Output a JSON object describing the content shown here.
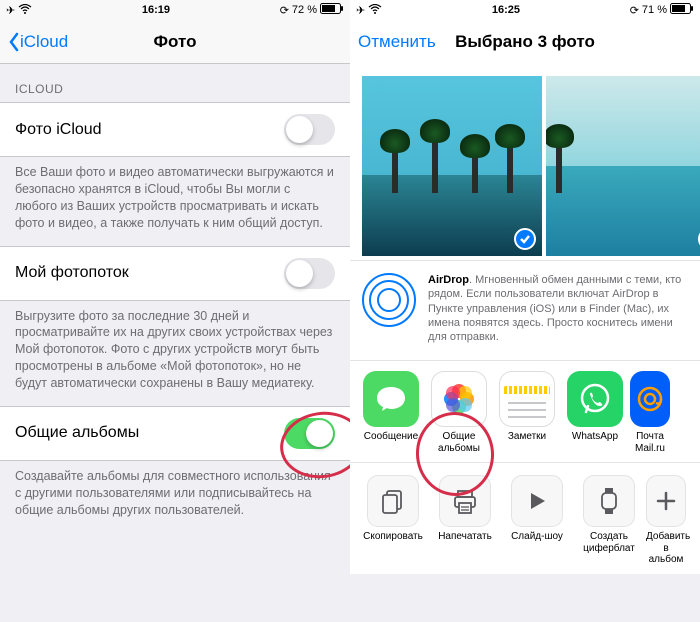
{
  "left": {
    "status": {
      "time": "16:19",
      "battery": "72 %"
    },
    "nav": {
      "back": "iCloud",
      "title": "Фото"
    },
    "section_header": "ICLOUD",
    "rows": [
      {
        "label": "Фото iCloud",
        "on": false,
        "desc": "Все Ваши фото и видео автоматически выгружаются и безопасно хранятся в iCloud, чтобы Вы могли с любого из Ваших устройств просматривать и искать фото и видео, а также получать к ним общий доступ."
      },
      {
        "label": "Мой фотопоток",
        "on": false,
        "desc": "Выгрузите фото за последние 30 дней и просматривайте их на других своих устройствах через Мой фотопоток. Фото с других устройств могут быть просмотрены в альбоме «Мой фотопоток», но не будут автоматически сохранены в Вашу медиатеку."
      },
      {
        "label": "Общие альбомы",
        "on": true,
        "desc": "Создавайте альбомы для совместного использования с другими пользователями или подписывайтесь на общие альбомы других пользователей."
      }
    ]
  },
  "right": {
    "status": {
      "time": "16:25",
      "battery": "71 %"
    },
    "nav": {
      "cancel": "Отменить",
      "title": "Выбрано 3 фото"
    },
    "airdrop": {
      "name": "AirDrop",
      "text": ". Мгновенный обмен данными с теми, кто рядом. Если пользователи включат AirDrop в Пункте управления (iOS) или в Finder (Mac), их имена появятся здесь. Просто коснитесь имени для отправки."
    },
    "share_apps": [
      {
        "label": "Сообщение",
        "color": "#4cd964",
        "icon": "message"
      },
      {
        "label": "Общие альбомы",
        "color": "#ffffff",
        "icon": "photos"
      },
      {
        "label": "Заметки",
        "color": "#fff9c4",
        "icon": "notes"
      },
      {
        "label": "WhatsApp",
        "color": "#25d366",
        "icon": "whatsapp"
      },
      {
        "label": "Почта Mail.ru",
        "color": "#005ff9",
        "icon": "mailru"
      }
    ],
    "actions": [
      {
        "label": "Скопировать",
        "icon": "copy"
      },
      {
        "label": "Напечатать",
        "icon": "print"
      },
      {
        "label": "Слайд-шоу",
        "icon": "play"
      },
      {
        "label": "Создать циферблат",
        "icon": "watch"
      },
      {
        "label": "Добавить в альбом",
        "icon": "plus"
      }
    ]
  }
}
